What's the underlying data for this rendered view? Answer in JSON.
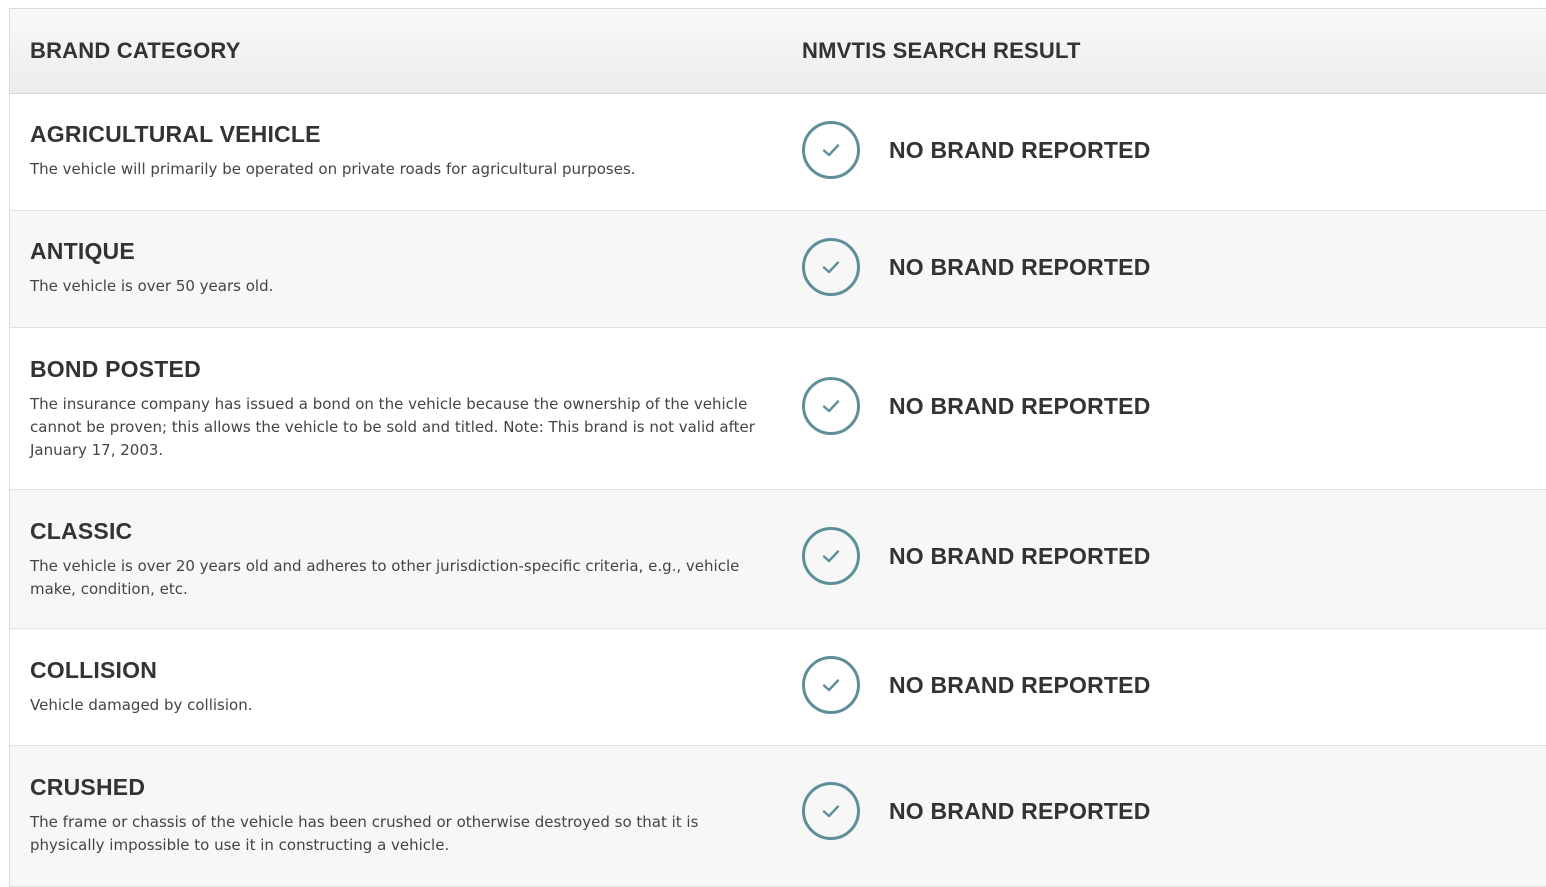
{
  "header": {
    "brand_category": "BRAND CATEGORY",
    "search_result": "NMVTIS SEARCH RESULT"
  },
  "rows": [
    {
      "title": "AGRICULTURAL VEHICLE",
      "description": "The vehicle will primarily be operated on private roads for agricultural purposes.",
      "result": "NO BRAND REPORTED",
      "icon": "check-circle-icon"
    },
    {
      "title": "ANTIQUE",
      "description": "The vehicle is over 50 years old.",
      "result": "NO BRAND REPORTED",
      "icon": "check-circle-icon"
    },
    {
      "title": "BOND POSTED",
      "description": "The insurance company has issued a bond on the vehicle because the ownership of the vehicle cannot be proven; this allows the vehicle to be sold and titled. Note: This brand is not valid after January 17, 2003.",
      "result": "NO BRAND REPORTED",
      "icon": "check-circle-icon"
    },
    {
      "title": "CLASSIC",
      "description": "The vehicle is over 20 years old and adheres to other jurisdiction-specific criteria, e.g., vehicle make, condition, etc.",
      "result": "NO BRAND REPORTED",
      "icon": "check-circle-icon"
    },
    {
      "title": "COLLISION",
      "description": "Vehicle damaged by collision.",
      "result": "NO BRAND REPORTED",
      "icon": "check-circle-icon"
    },
    {
      "title": "CRUSHED",
      "description": "The frame or chassis of the vehicle has been crushed or otherwise destroyed so that it is physically impossible to use it in constructing a vehicle.",
      "result": "NO BRAND REPORTED",
      "icon": "check-circle-icon"
    }
  ],
  "colors": {
    "check_ring": "#5e8f99",
    "text": "#333333"
  }
}
